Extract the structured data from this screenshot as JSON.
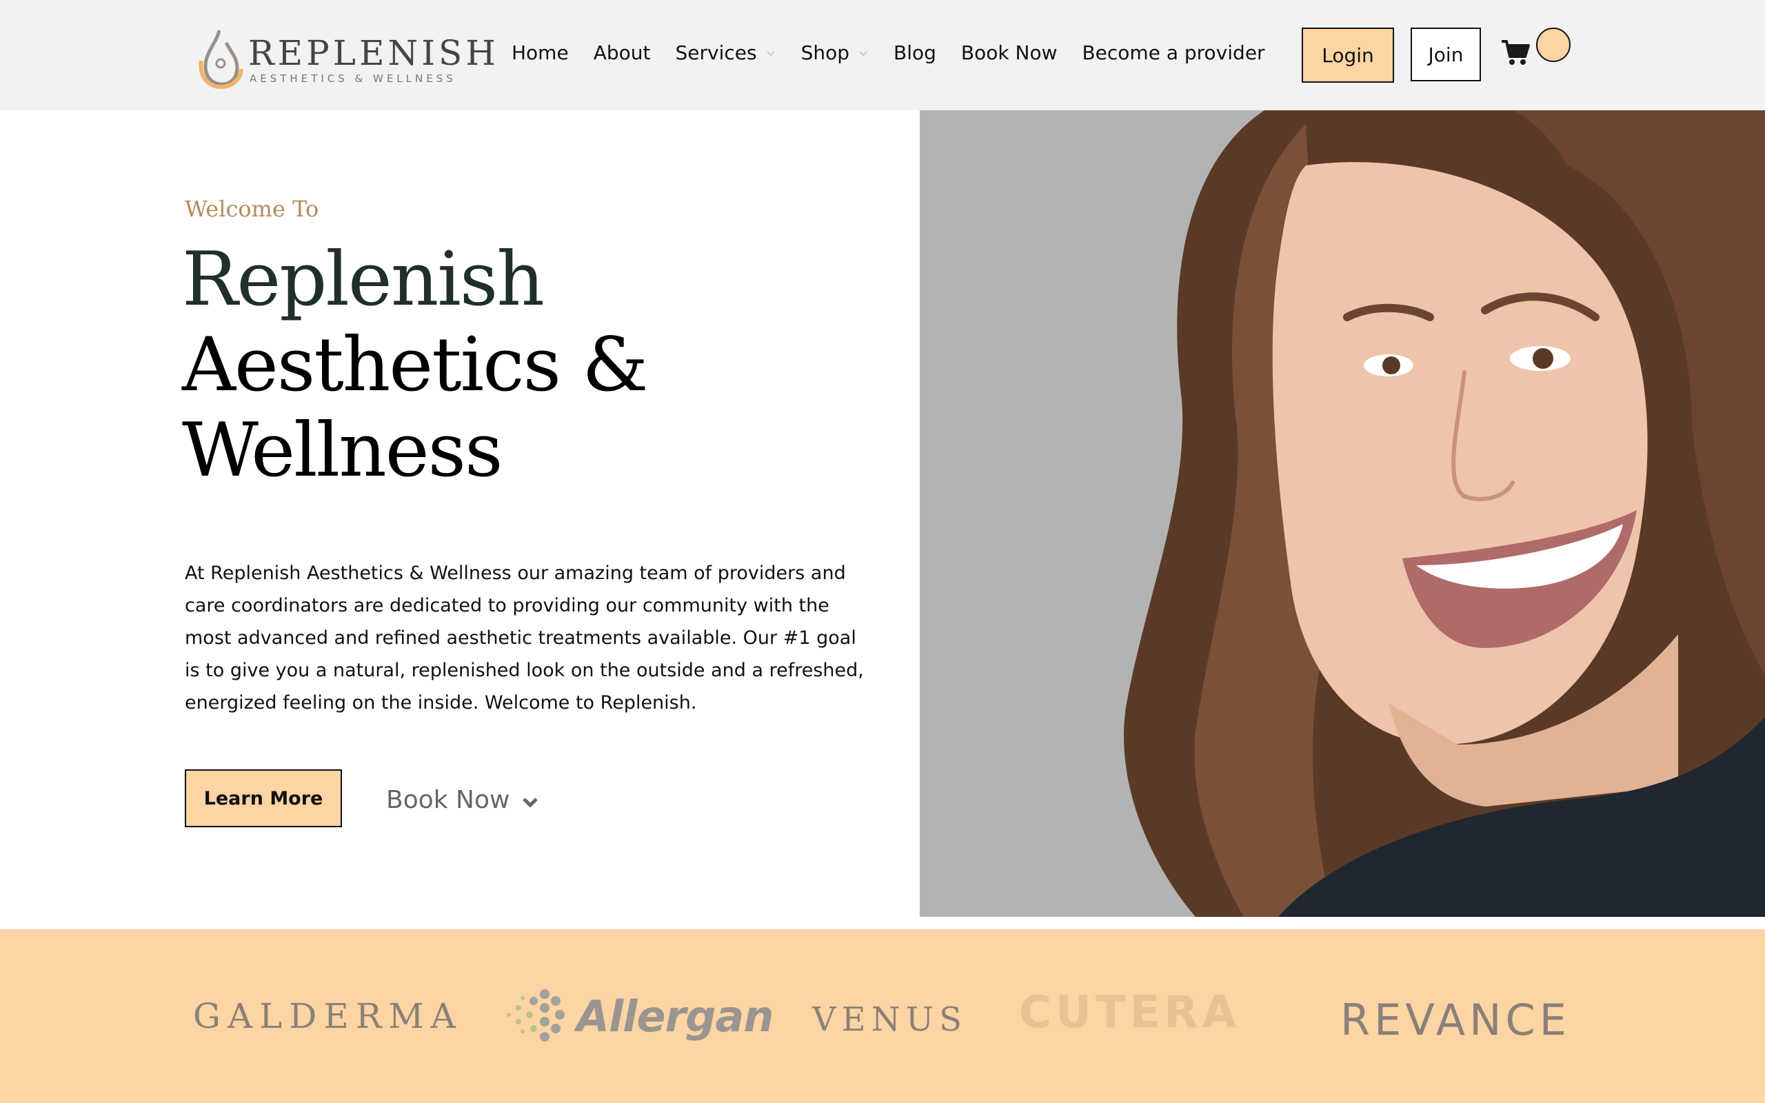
{
  "header": {
    "logo": {
      "wordmark": "REPLENISH",
      "tagline": "AESTHETICS & WELLNESS"
    },
    "nav": [
      {
        "label": "Home"
      },
      {
        "label": "About"
      },
      {
        "label": "Services",
        "has_dropdown": true
      },
      {
        "label": "Shop",
        "has_dropdown": true
      },
      {
        "label": "Blog"
      },
      {
        "label": "Book Now"
      },
      {
        "label": "Become a provider"
      }
    ],
    "login_label": "Login",
    "join_label": "Join",
    "cart_icon": "shopping-cart-icon"
  },
  "hero": {
    "eyebrow": "Welcome To",
    "title_lines": [
      "Replenish",
      "Aesthetics &",
      "Wellness"
    ],
    "body": "At Replenish Aesthetics & Wellness our amazing team of providers and care coordinators are dedicated to providing our community with the most advanced and refined aesthetic treatments available. Our #1 goal is to give you a natural, replenished look on the outside and a refreshed, energized feeling on the inside. Welcome to Replenish.",
    "learn_more_label": "Learn More",
    "book_now_label": "Book Now",
    "image": "smiling-woman-portrait"
  },
  "brands": {
    "logos": [
      "GALDERMA",
      "Allergan",
      "VENUS",
      "CUTERA",
      "REVANCE"
    ]
  },
  "colors": {
    "accent_peach": "#fdd4a3",
    "header_bg": "#f2f2f2",
    "eyebrow_gold": "#b38a5c",
    "hero_image_bg": "#b3b3b3"
  }
}
